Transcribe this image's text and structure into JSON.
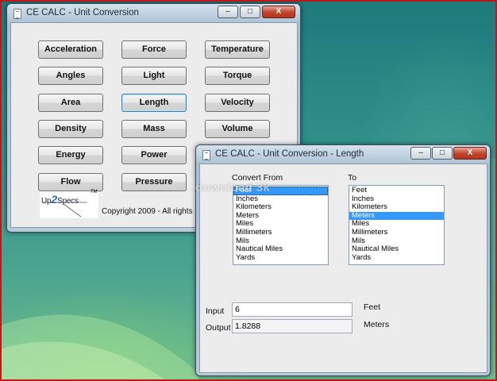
{
  "main_window": {
    "title": "CE CALC - Unit Conversion",
    "controls": {
      "minimize": "–",
      "maximize": "□",
      "close": "X"
    },
    "buttons": [
      "Acceleration",
      "Force",
      "Temperature",
      "Angles",
      "Light",
      "Torque",
      "Area",
      "Length",
      "Velocity",
      "Density",
      "Mass",
      "Volume",
      "Energy",
      "Power",
      "",
      "Flow",
      "Pressure",
      ""
    ],
    "logo": {
      "left": "Up",
      "two": "2",
      "right": "Specs",
      "tm": "TM"
    },
    "copyright": "Copyright 2009 - All rights rese"
  },
  "length_window": {
    "title": "CE CALC - Unit Conversion - Length",
    "controls": {
      "minimize": "–",
      "maximize": "□",
      "close": "X"
    },
    "convert_from_label": "Convert From",
    "to_label": "To",
    "from_options": [
      "Feet",
      "Inches",
      "Kilometers",
      "Meters",
      "Miles",
      "Millimeters",
      "Mils",
      "Nautical Miles",
      "Yards"
    ],
    "from_selected": "Feet",
    "to_options": [
      "Feet",
      "Inches",
      "Kilometers",
      "Meters",
      "Miles",
      "Millimeters",
      "Mils",
      "Nautical Miles",
      "Yards"
    ],
    "to_selected": "Meters",
    "input_label": "Input",
    "input_value": "6",
    "input_unit": "Feet",
    "output_label": "Output",
    "output_value": "1.8288",
    "output_unit": "Meters"
  },
  "watermark": "download 3k"
}
